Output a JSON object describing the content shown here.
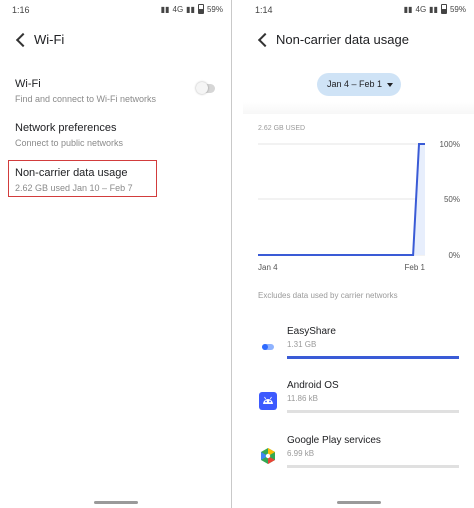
{
  "left_screen": {
    "status": {
      "time": "1:16",
      "net": "4G",
      "battery": "59%"
    },
    "header": {
      "title": "Wi-Fi"
    },
    "items": [
      {
        "title": "Wi-Fi",
        "subtitle": "Find and connect to Wi-Fi networks"
      },
      {
        "title": "Network preferences",
        "subtitle": "Connect to public networks"
      },
      {
        "title": "Non-carrier data usage",
        "subtitle": "2.62 GB used Jan 10 – Feb 7"
      }
    ],
    "wifi_toggle_on": false
  },
  "right_screen": {
    "status": {
      "time": "1:14",
      "net": "4G",
      "battery": "59%"
    },
    "header": {
      "title": "Non-carrier data usage"
    },
    "cycle": {
      "label": "Jan 4 – Feb 1"
    },
    "chart_data": {
      "type": "line",
      "title": "2.62 GB USED",
      "x_labels": [
        "Jan 4",
        "Feb 1"
      ],
      "y_ticks": [
        "100%",
        "50%",
        "0%"
      ],
      "ylim": [
        0,
        100
      ],
      "x": [
        0,
        26,
        27,
        28
      ],
      "y": [
        0,
        0,
        100,
        100
      ],
      "series_color": "#3a5bd6"
    },
    "note": "Excludes data used by carrier networks",
    "apps": [
      {
        "name": "EasyShare",
        "usage": "1.31 GB",
        "fraction": 1.0,
        "icon": "easyshare-icon",
        "color": "#3a5bd6"
      },
      {
        "name": "Android OS",
        "usage": "11.86 kB",
        "fraction": 0.0,
        "icon": "android-icon",
        "color": "#3d5afe"
      },
      {
        "name": "Google Play services",
        "usage": "6.99 kB",
        "fraction": 0.0,
        "icon": "play-services-icon",
        "color": "#34a853"
      }
    ]
  }
}
